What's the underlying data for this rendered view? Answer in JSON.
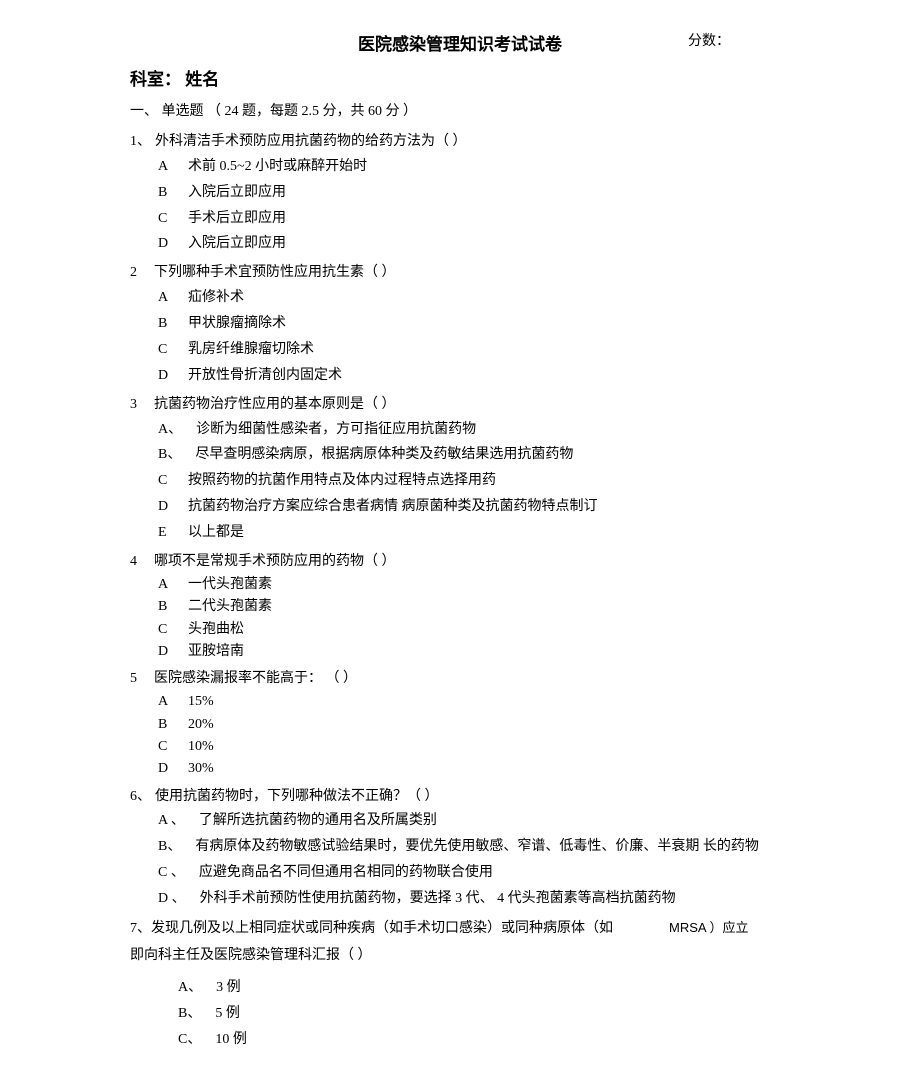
{
  "title": "医院感染管理知识考试试卷",
  "score_label": "分数：",
  "dept_row": "科室：   姓名",
  "section1": "一、 单选题 （ 24 题，每题 2.5 分，共 60 分 ）",
  "q1": {
    "num": "1、",
    "stem": "外科清洁手术预防应用抗菌药物的给药方法为（   ）",
    "A": "术前 0.5~2 小时或麻醉开始时",
    "B": "入院后立即应用",
    "C": "手术后立即应用",
    "D": "入院后立即应用"
  },
  "q2": {
    "num": "2",
    "stem": "下列哪种手术宜预防性应用抗生素（            ）",
    "A": "疝修补术",
    "B": "甲状腺瘤摘除术",
    "C": "乳房纤维腺瘤切除术",
    "D": "开放性骨折清创内固定术"
  },
  "q3": {
    "num": "3",
    "stem": "抗菌药物治疗性应用的基本原则是（              ）",
    "A": "诊断为细菌性感染者，方可指征应用抗菌药物",
    "B": "尽早查明感染病原，根据病原体种类及药敏结果选用抗菌药物",
    "C": "按照药物的抗菌作用特点及体内过程特点选择用药",
    "D": "抗菌药物治疗方案应综合患者病情    病原菌种类及抗菌药物特点制订",
    "E": "以上都是"
  },
  "q4": {
    "num": "4",
    "stem": "哪项不是常规手术预防应用的药物（               ）",
    "A": "一代头孢菌素",
    "B": "二代头孢菌素",
    "C": "头孢曲松",
    "D": "亚胺培南"
  },
  "q5": {
    "num": "5",
    "stem": "医院感染漏报率不能高于：  （   ）",
    "A": "15%",
    "B": "20%",
    "C": "10%",
    "D": "30%"
  },
  "q6": {
    "num": "6、",
    "stem": "使用抗菌药物时，下列哪种做法不正确？（   ）",
    "A": "了解所选抗菌药物的通用名及所属类别",
    "B": "有病原体及药物敏感试验结果时，要优先使用敏感、窄谱、低毒性、价廉、半衰期 长的药物",
    "C": "应避免商品名不同但通用名相同的药物联合使用",
    "D": "外科手术前预防性使用抗菌药物，要选择       3 代、 4 代头孢菌素等高档抗菌药物"
  },
  "q7": {
    "num": "7、",
    "line1_a": "发现几例及以上相同症状或同种疾病（如手术切口感染）或同种病原体（如",
    "line1_b": "MRSA ）应立",
    "line2": "即向科主任及医院感染管理科汇报（   ）",
    "A": "3 例",
    "B": "5 例",
    "C": "10 例"
  }
}
